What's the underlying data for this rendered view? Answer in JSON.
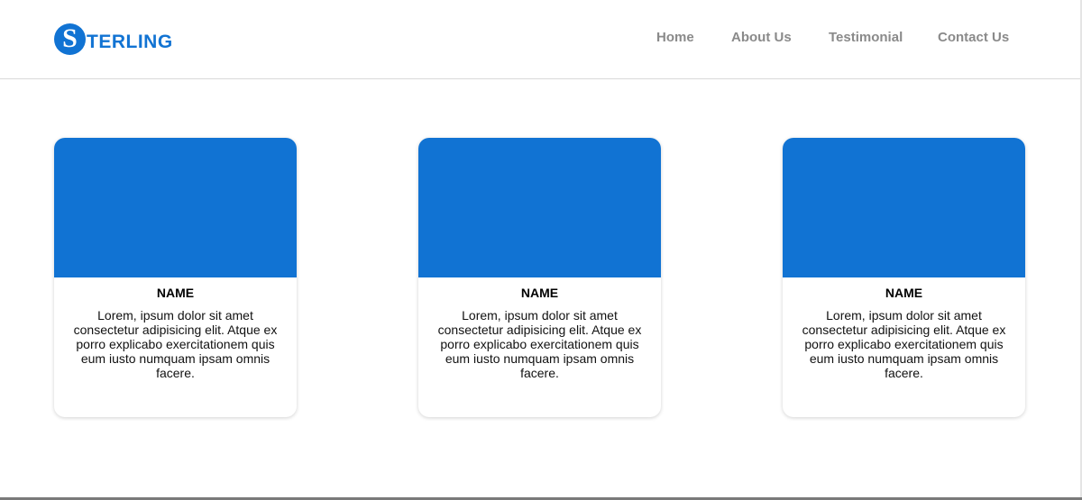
{
  "brand": {
    "initial": "S",
    "rest": "TERLING",
    "color": "#1173d3"
  },
  "nav": {
    "items": [
      {
        "label": "Home"
      },
      {
        "label": "About Us"
      },
      {
        "label": "Testimonial"
      },
      {
        "label": "Contact Us"
      }
    ]
  },
  "cards": [
    {
      "name": "NAME",
      "text": "Lorem, ipsum dolor sit amet consectetur adipisicing elit. Atque ex porro explicabo exercitationem quis eum iusto numquam ipsam omnis facere."
    },
    {
      "name": "NAME",
      "text": "Lorem, ipsum dolor sit amet consectetur adipisicing elit. Atque ex porro explicabo exercitationem quis eum iusto numquam ipsam omnis facere."
    },
    {
      "name": "NAME",
      "text": "Lorem, ipsum dolor sit amet consectetur adipisicing elit. Atque ex porro explicabo exercitationem quis eum iusto numquam ipsam omnis facere."
    }
  ]
}
